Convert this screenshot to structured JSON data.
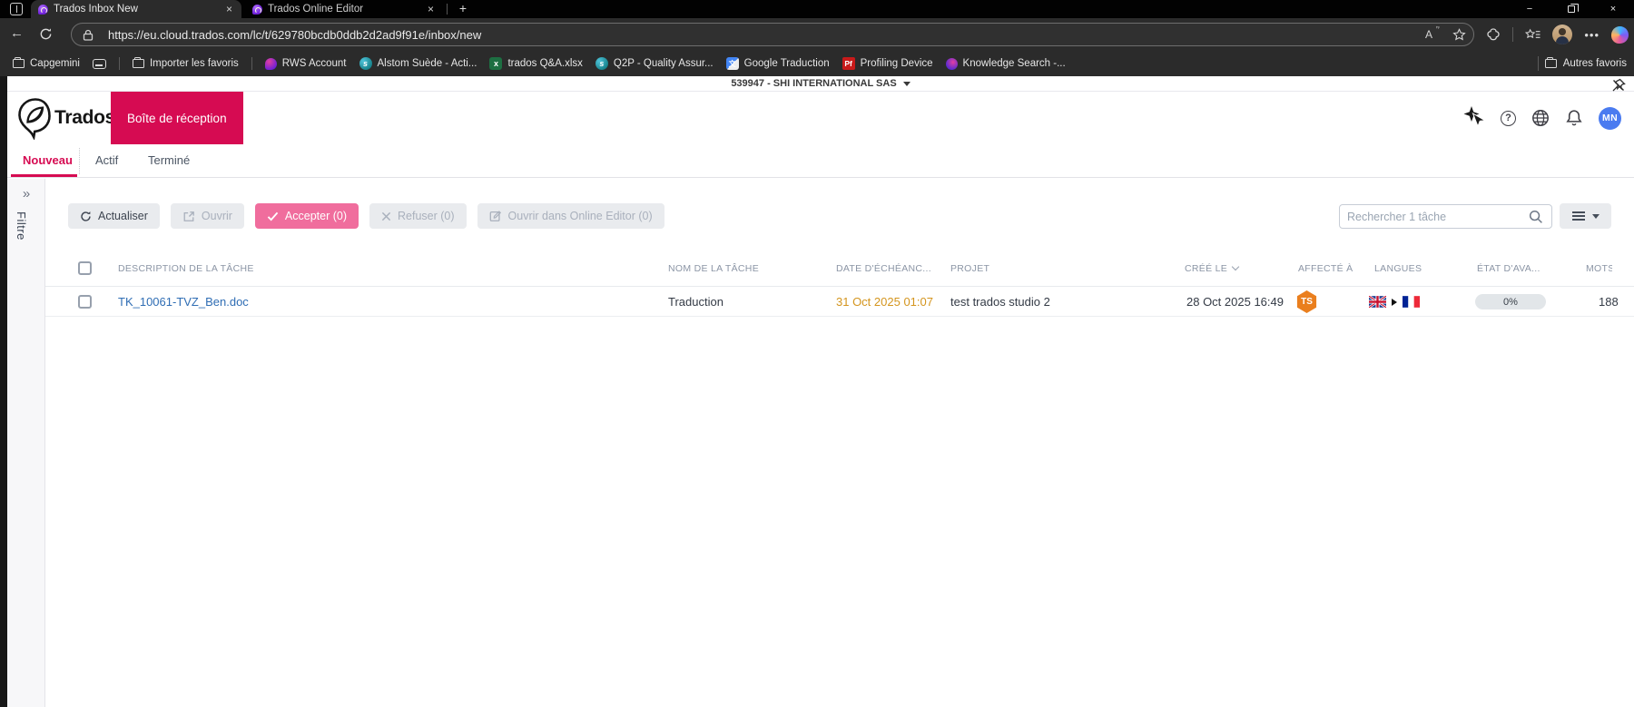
{
  "browser": {
    "tabs": [
      {
        "title": "Trados Inbox New"
      },
      {
        "title": "Trados Online Editor"
      }
    ],
    "url": "https://eu.cloud.trados.com/lc/t/629780bcdb0ddb2d2ad9f91e/inbox/new",
    "bookmarks": [
      {
        "label": "Capgemini"
      },
      {
        "label": "Importer les favoris"
      },
      {
        "label": "RWS Account"
      },
      {
        "label": "Alstom Suède - Acti..."
      },
      {
        "label": "trados Q&A.xlsx"
      },
      {
        "label": "Q2P - Quality Assur..."
      },
      {
        "label": "Google Traduction"
      },
      {
        "label": "Profiling Device"
      },
      {
        "label": "Knowledge Search -..."
      }
    ],
    "other_favorites": "Autres favoris",
    "bookmark_badges": {
      "sharepoint": "s",
      "excel": "x",
      "translate": "文",
      "pf": "Pf"
    }
  },
  "glyphs": {
    "close": "×",
    "plus": "+",
    "minimize": "−",
    "back": "←",
    "refresh_tab": "⟳",
    "more": "•••",
    "read_aloud": "A",
    "star": "☆",
    "double_chevron": "»",
    "question": "?"
  },
  "account_bar": {
    "company": "539947 - SHI INTERNATIONAL SAS"
  },
  "app_header": {
    "brand": "Trados",
    "inbox_button": "Boîte de réception",
    "avatar_initials": "MN"
  },
  "nav_tabs": [
    {
      "label": "Nouveau",
      "active": true
    },
    {
      "label": "Actif",
      "active": false
    },
    {
      "label": "Terminé",
      "active": false
    }
  ],
  "filter_panel": {
    "label": "Filtre"
  },
  "toolbar": {
    "refresh": "Actualiser",
    "open": "Ouvrir",
    "accept": "Accepter (0)",
    "reject": "Refuser (0)",
    "open_online_editor": "Ouvrir dans Online Editor (0)",
    "search_placeholder": "Rechercher 1 tâche"
  },
  "table": {
    "headers": {
      "description": "DESCRIPTION DE LA TÂCHE",
      "name": "NOM DE LA TÂCHE",
      "due": "DATE D'ÉCHÉANC...",
      "project": "PROJET",
      "created": "CRÉÉ LE",
      "assigned": "AFFECTÉ À",
      "languages": "LANGUES",
      "progress": "ÉTAT D'AVA...",
      "words": "MOTS"
    },
    "row": {
      "description": "TK_10061-TVZ_Ben.doc",
      "name": "Traduction",
      "due": "31 Oct 2025 01:07",
      "project": "test trados studio 2",
      "created": "28 Oct 2025 16:49",
      "assignee_badge": "TS",
      "languages": {
        "source": "en-GB",
        "target": "fr-FR"
      },
      "progress": "0%",
      "words": "188"
    }
  },
  "colors": {
    "brand_pink": "#d60b52",
    "accept_pink": "#f06d9d",
    "badge_orange": "#ea7f1e",
    "due_amber": "#d4951e",
    "link_blue": "#2f6db4",
    "avatar_blue": "#4a7bf0"
  }
}
